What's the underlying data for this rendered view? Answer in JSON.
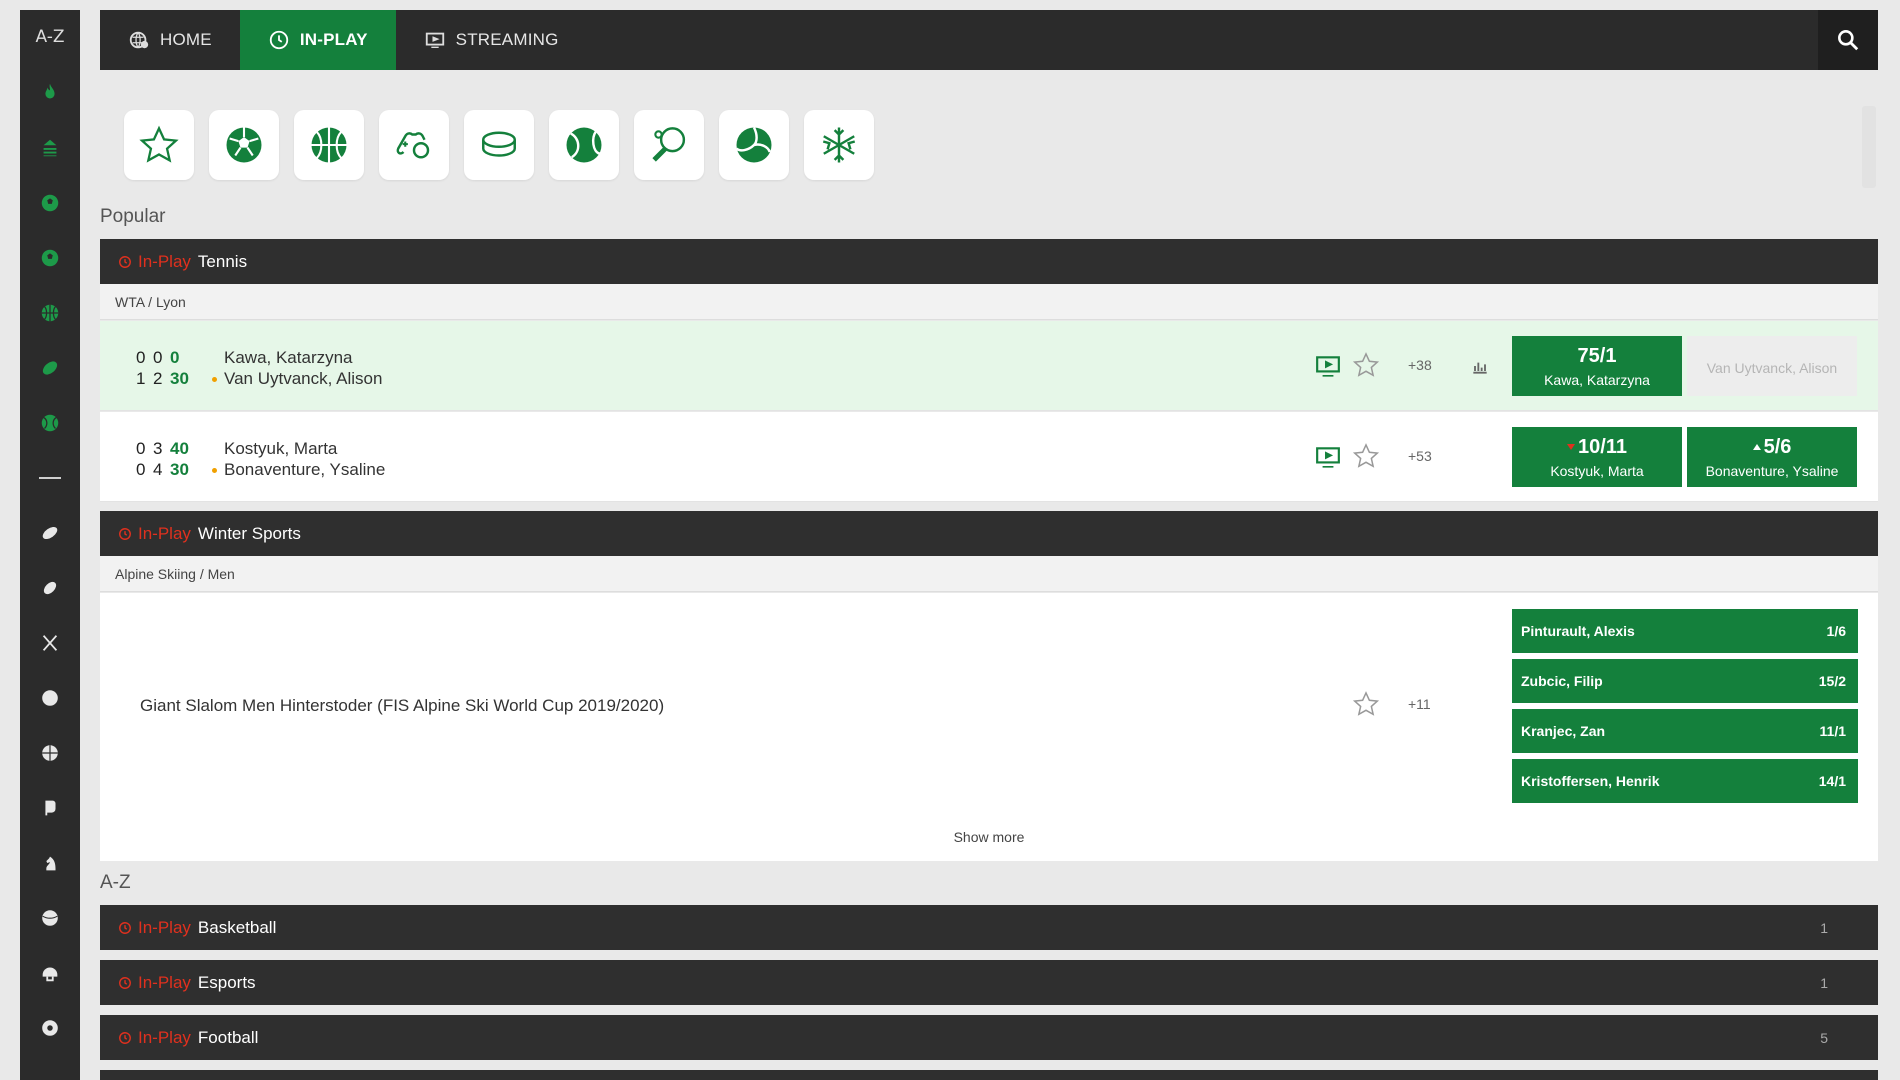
{
  "rail": {
    "az_label": "A-Z"
  },
  "nav": {
    "tabs": [
      {
        "label": "HOME",
        "icon": "globe-icon"
      },
      {
        "label": "IN-PLAY",
        "icon": "clock-icon",
        "active": true
      },
      {
        "label": "STREAMING",
        "icon": "screen-icon"
      }
    ],
    "search_icon": "search-icon"
  },
  "filters": [
    "favourites-star-icon",
    "football-icon",
    "basketball-icon",
    "esports-controller-icon",
    "ice-hockey-puck-icon",
    "tennis-ball-icon",
    "table-tennis-icon",
    "volleyball-icon",
    "winter-sports-snowflake-icon"
  ],
  "popular": {
    "label": "Popular",
    "tennis": {
      "inplay_label": "In-Play",
      "sport": "Tennis",
      "league": "WTA / Lyon",
      "matches": [
        {
          "row1": {
            "sets": "0",
            "games": "0",
            "points": "0",
            "name": "Kawa, Katarzyna"
          },
          "row2": {
            "sets": "1",
            "games": "2",
            "points": "30",
            "name": "Van Uytvanck, Alison"
          },
          "more": "+38",
          "odd1": {
            "price": "75/1",
            "who": "Kawa, Katarzyna"
          },
          "odd2": {
            "price": "",
            "who": "Van Uytvanck, Alison",
            "suspended": true
          }
        },
        {
          "row1": {
            "sets": "0",
            "games": "3",
            "points": "40",
            "name": "Kostyuk, Marta"
          },
          "row2": {
            "sets": "0",
            "games": "4",
            "points": "30",
            "name": "Bonaventure, Ysaline"
          },
          "more": "+53",
          "odd1": {
            "price": "10/11",
            "who": "Kostyuk, Marta",
            "trend": "down"
          },
          "odd2": {
            "price": "5/6",
            "who": "Bonaventure, Ysaline",
            "trend": "up"
          }
        }
      ]
    },
    "winter": {
      "inplay_label": "In-Play",
      "sport": "Winter Sports",
      "league": "Alpine Skiing / Men",
      "event": "Giant Slalom Men Hinterstoder (FIS Alpine Ski World Cup 2019/2020)",
      "more": "+11",
      "runners": [
        {
          "name": "Pinturault, Alexis",
          "price": "1/6"
        },
        {
          "name": "Zubcic, Filip",
          "price": "15/2"
        },
        {
          "name": "Kranjec, Zan",
          "price": "11/1"
        },
        {
          "name": "Kristoffersen, Henrik",
          "price": "14/1"
        }
      ],
      "show_more": "Show more"
    }
  },
  "az": {
    "label": "A-Z",
    "groups": [
      {
        "inplay_label": "In-Play",
        "sport": "Basketball",
        "count": "1"
      },
      {
        "inplay_label": "In-Play",
        "sport": "Esports",
        "count": "1"
      },
      {
        "inplay_label": "In-Play",
        "sport": "Football",
        "count": "5"
      }
    ]
  },
  "colors": {
    "green": "#14803c",
    "dark": "#2b2b2b",
    "red": "#e0301e",
    "light_green": "#e6f7e8"
  }
}
